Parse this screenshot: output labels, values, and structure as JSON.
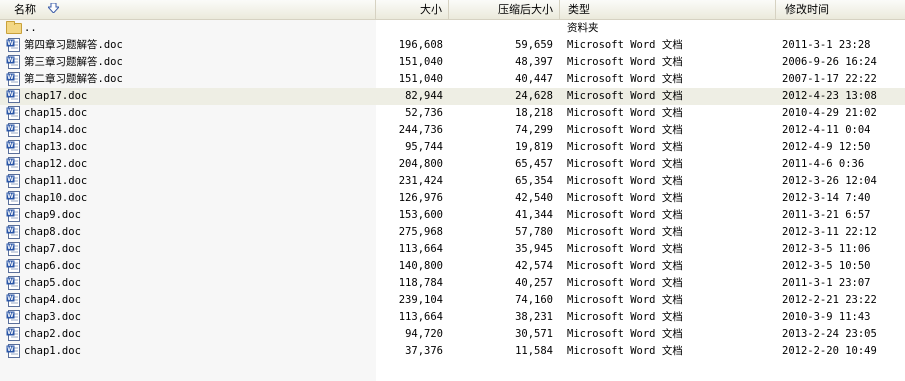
{
  "columns": {
    "name": "名称",
    "size": "大小",
    "compressed": "压缩后大小",
    "type": "类型",
    "modified": "修改时间"
  },
  "parent_row": {
    "name": "..",
    "type": "资料夹",
    "icon": "folder-icon"
  },
  "files": [
    {
      "name": "第四章习题解答.doc",
      "size": "196,608",
      "compressed": "59,659",
      "type": "Microsoft Word 文档",
      "modified": "2011-3-1 23:28"
    },
    {
      "name": "第三章习题解答.doc",
      "size": "151,040",
      "compressed": "48,397",
      "type": "Microsoft Word 文档",
      "modified": "2006-9-26 16:24"
    },
    {
      "name": "第二章习题解答.doc",
      "size": "151,040",
      "compressed": "40,447",
      "type": "Microsoft Word 文档",
      "modified": "2007-1-17 22:22"
    },
    {
      "name": "chap17.doc",
      "size": "82,944",
      "compressed": "24,628",
      "type": "Microsoft Word 文档",
      "modified": "2012-4-23 13:08"
    },
    {
      "name": "chap15.doc",
      "size": "52,736",
      "compressed": "18,218",
      "type": "Microsoft Word 文档",
      "modified": "2010-4-29 21:02"
    },
    {
      "name": "chap14.doc",
      "size": "244,736",
      "compressed": "74,299",
      "type": "Microsoft Word 文档",
      "modified": "2012-4-11 0:04"
    },
    {
      "name": "chap13.doc",
      "size": "95,744",
      "compressed": "19,819",
      "type": "Microsoft Word 文档",
      "modified": "2012-4-9 12:50"
    },
    {
      "name": "chap12.doc",
      "size": "204,800",
      "compressed": "65,457",
      "type": "Microsoft Word 文档",
      "modified": "2011-4-6 0:36"
    },
    {
      "name": "chap11.doc",
      "size": "231,424",
      "compressed": "65,354",
      "type": "Microsoft Word 文档",
      "modified": "2012-3-26 12:04"
    },
    {
      "name": "chap10.doc",
      "size": "126,976",
      "compressed": "42,540",
      "type": "Microsoft Word 文档",
      "modified": "2012-3-14 7:40"
    },
    {
      "name": "chap9.doc",
      "size": "153,600",
      "compressed": "41,344",
      "type": "Microsoft Word 文档",
      "modified": "2011-3-21 6:57"
    },
    {
      "name": "chap8.doc",
      "size": "275,968",
      "compressed": "57,780",
      "type": "Microsoft Word 文档",
      "modified": "2012-3-11 22:12"
    },
    {
      "name": "chap7.doc",
      "size": "113,664",
      "compressed": "35,945",
      "type": "Microsoft Word 文档",
      "modified": "2012-3-5 11:06"
    },
    {
      "name": "chap6.doc",
      "size": "140,800",
      "compressed": "42,574",
      "type": "Microsoft Word 文档",
      "modified": "2012-3-5 10:50"
    },
    {
      "name": "chap5.doc",
      "size": "118,784",
      "compressed": "40,257",
      "type": "Microsoft Word 文档",
      "modified": "2011-3-1 23:07"
    },
    {
      "name": "chap4.doc",
      "size": "239,104",
      "compressed": "74,160",
      "type": "Microsoft Word 文档",
      "modified": "2012-2-21 23:22"
    },
    {
      "name": "chap3.doc",
      "size": "113,664",
      "compressed": "38,231",
      "type": "Microsoft Word 文档",
      "modified": "2010-3-9 11:43"
    },
    {
      "name": "chap2.doc",
      "size": "94,720",
      "compressed": "30,571",
      "type": "Microsoft Word 文档",
      "modified": "2013-2-24 23:05"
    },
    {
      "name": "chap1.doc",
      "size": "37,376",
      "compressed": "11,584",
      "type": "Microsoft Word 文档",
      "modified": "2012-2-20 10:49"
    }
  ],
  "selected_index": 3,
  "file_icon": "word-document-icon",
  "colors": {
    "selected_row": "#eeeee4",
    "header_bg": "#ebeadb",
    "name_column_bg": "#f7f7f7"
  }
}
